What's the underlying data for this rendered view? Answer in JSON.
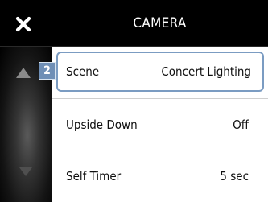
{
  "header": {
    "title": "CAMERA",
    "close_icon": "close-x-icon"
  },
  "nav": {
    "up_icon": "scroll-up-triangle-icon",
    "down_icon": "scroll-down-triangle-icon",
    "selected_number": "2"
  },
  "settings": [
    {
      "label": "Scene",
      "value": "Concert Lighting",
      "selected": true
    },
    {
      "label": "Upside Down",
      "value": "Off",
      "selected": false
    },
    {
      "label": "Self Timer",
      "value": "5 sec",
      "selected": false
    }
  ],
  "colors": {
    "highlight_border": "#7b9cc2",
    "badge": "#6f8fb6"
  }
}
